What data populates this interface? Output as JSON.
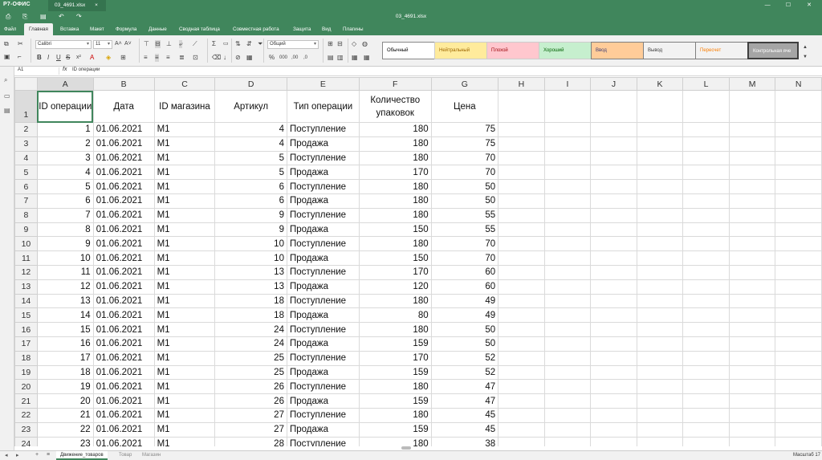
{
  "app": {
    "logo": "Р7-ОФИС",
    "file_tab": "03_4691.xlsx",
    "doc_title": "03_4691.xlsx"
  },
  "menu": {
    "tabs": [
      "Файл",
      "Главная",
      "Вставка",
      "Макет",
      "Формула",
      "Данные",
      "Сводная таблица",
      "Совместная работа",
      "Защита",
      "Вид",
      "Плагины"
    ],
    "active": "Главная"
  },
  "ribbon": {
    "font_name": "Calibri",
    "font_size": "11",
    "number_format": "Общий",
    "cell_styles": [
      "Обычный",
      "Нейтральный",
      "Плохой",
      "Хороший",
      "Ввод",
      "Вывод",
      "Пересчет",
      "Контрольная яче"
    ]
  },
  "formula_bar": {
    "name_box": "A1",
    "fx": "fx",
    "content": "ID операции"
  },
  "columns": [
    "A",
    "B",
    "C",
    "D",
    "E",
    "F",
    "G",
    "H",
    "I",
    "J",
    "K",
    "L",
    "M",
    "N"
  ],
  "header_row": [
    "ID операции",
    "Дата",
    "ID магазина",
    "Артикул",
    "Тип операции",
    "Количество упаковок",
    "Цена"
  ],
  "rows": [
    {
      "n": "2",
      "cells": [
        "1",
        "01.06.2021",
        "M1",
        "4",
        "Поступление",
        "180",
        "75"
      ]
    },
    {
      "n": "3",
      "cells": [
        "2",
        "01.06.2021",
        "M1",
        "4",
        "Продажа",
        "180",
        "75"
      ]
    },
    {
      "n": "4",
      "cells": [
        "3",
        "01.06.2021",
        "M1",
        "5",
        "Поступление",
        "180",
        "70"
      ]
    },
    {
      "n": "5",
      "cells": [
        "4",
        "01.06.2021",
        "M1",
        "5",
        "Продажа",
        "170",
        "70"
      ]
    },
    {
      "n": "6",
      "cells": [
        "5",
        "01.06.2021",
        "M1",
        "6",
        "Поступление",
        "180",
        "50"
      ]
    },
    {
      "n": "7",
      "cells": [
        "6",
        "01.06.2021",
        "M1",
        "6",
        "Продажа",
        "180",
        "50"
      ]
    },
    {
      "n": "8",
      "cells": [
        "7",
        "01.06.2021",
        "M1",
        "9",
        "Поступление",
        "180",
        "55"
      ]
    },
    {
      "n": "9",
      "cells": [
        "8",
        "01.06.2021",
        "M1",
        "9",
        "Продажа",
        "150",
        "55"
      ]
    },
    {
      "n": "10",
      "cells": [
        "9",
        "01.06.2021",
        "M1",
        "10",
        "Поступление",
        "180",
        "70"
      ]
    },
    {
      "n": "11",
      "cells": [
        "10",
        "01.06.2021",
        "M1",
        "10",
        "Продажа",
        "150",
        "70"
      ]
    },
    {
      "n": "12",
      "cells": [
        "11",
        "01.06.2021",
        "M1",
        "13",
        "Поступление",
        "170",
        "60"
      ]
    },
    {
      "n": "13",
      "cells": [
        "12",
        "01.06.2021",
        "M1",
        "13",
        "Продажа",
        "120",
        "60"
      ]
    },
    {
      "n": "14",
      "cells": [
        "13",
        "01.06.2021",
        "M1",
        "18",
        "Поступление",
        "180",
        "49"
      ]
    },
    {
      "n": "15",
      "cells": [
        "14",
        "01.06.2021",
        "M1",
        "18",
        "Продажа",
        "80",
        "49"
      ]
    },
    {
      "n": "16",
      "cells": [
        "15",
        "01.06.2021",
        "M1",
        "24",
        "Поступление",
        "180",
        "50"
      ]
    },
    {
      "n": "17",
      "cells": [
        "16",
        "01.06.2021",
        "M1",
        "24",
        "Продажа",
        "159",
        "50"
      ]
    },
    {
      "n": "18",
      "cells": [
        "17",
        "01.06.2021",
        "M1",
        "25",
        "Поступление",
        "170",
        "52"
      ]
    },
    {
      "n": "19",
      "cells": [
        "18",
        "01.06.2021",
        "M1",
        "25",
        "Продажа",
        "159",
        "52"
      ]
    },
    {
      "n": "20",
      "cells": [
        "19",
        "01.06.2021",
        "M1",
        "26",
        "Поступление",
        "180",
        "47"
      ]
    },
    {
      "n": "21",
      "cells": [
        "20",
        "01.06.2021",
        "M1",
        "26",
        "Продажа",
        "159",
        "47"
      ]
    },
    {
      "n": "22",
      "cells": [
        "21",
        "01.06.2021",
        "M1",
        "27",
        "Поступление",
        "180",
        "45"
      ]
    },
    {
      "n": "23",
      "cells": [
        "22",
        "01.06.2021",
        "M1",
        "27",
        "Продажа",
        "159",
        "45"
      ]
    },
    {
      "n": "24",
      "cells": [
        "23",
        "01.06.2021",
        "M1",
        "28",
        "Поступление",
        "180",
        "38"
      ]
    }
  ],
  "sheets": {
    "tabs": [
      "Движение_товаров",
      "Товар",
      "Магазин"
    ],
    "active": "Движение_товаров"
  },
  "status": {
    "zoom": "Масштаб 17"
  },
  "icons": {
    "save": "save-icon",
    "print": "print-icon",
    "undo": "undo-icon",
    "redo": "redo-icon",
    "search": "search-icon",
    "comment": "comment-icon",
    "chat": "chat-icon"
  }
}
